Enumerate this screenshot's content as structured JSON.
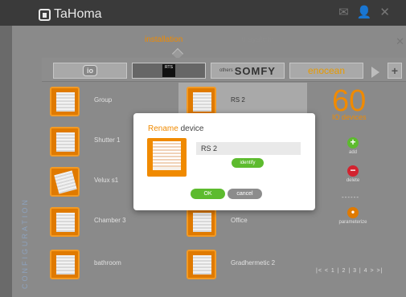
{
  "app": {
    "brand": "TaHoma",
    "top_icons": [
      "mail-icon",
      "user-icon",
      "close-icon"
    ]
  },
  "tabs": [
    {
      "label": "installation",
      "active": true
    },
    {
      "label": "io system",
      "active": false
    }
  ],
  "filters": {
    "io": "io",
    "rts": "RTS",
    "others": "others",
    "somfy": "SOMFY",
    "enocean": "enocean"
  },
  "sidebar": {
    "label": "CONFIGURATION"
  },
  "devices": [
    {
      "label": "Group",
      "icon": "shutter-icon"
    },
    {
      "label": "RS 2",
      "icon": "shutter-icon",
      "selected": true
    },
    {
      "label": "Shutter 1",
      "icon": "shutter-icon"
    },
    {
      "label": "Velux s1",
      "icon": "window-icon"
    },
    {
      "label": "Chamber 3",
      "icon": "shutter-icon"
    },
    {
      "label": "Office",
      "icon": "shutter-icon"
    },
    {
      "label": "bathroom",
      "icon": "shutter-icon"
    },
    {
      "label": "Gradhermetic 2",
      "icon": "shutter-icon"
    }
  ],
  "summary": {
    "count": "60",
    "label": "IO devices"
  },
  "actions": {
    "add": "add",
    "delete": "delete",
    "dashes": "------",
    "parameterize": "parameterize"
  },
  "pager": {
    "text": "|< < 1 | 2 | 3 | 4 > >|"
  },
  "modal": {
    "title_accent": "Rename",
    "title_rest": " device",
    "value": "RS 2",
    "identify": "identify",
    "ok": "OK",
    "cancel": "cancel"
  },
  "colors": {
    "accent": "#f08a00",
    "green": "#5dbb2e",
    "red": "#d3232f"
  }
}
